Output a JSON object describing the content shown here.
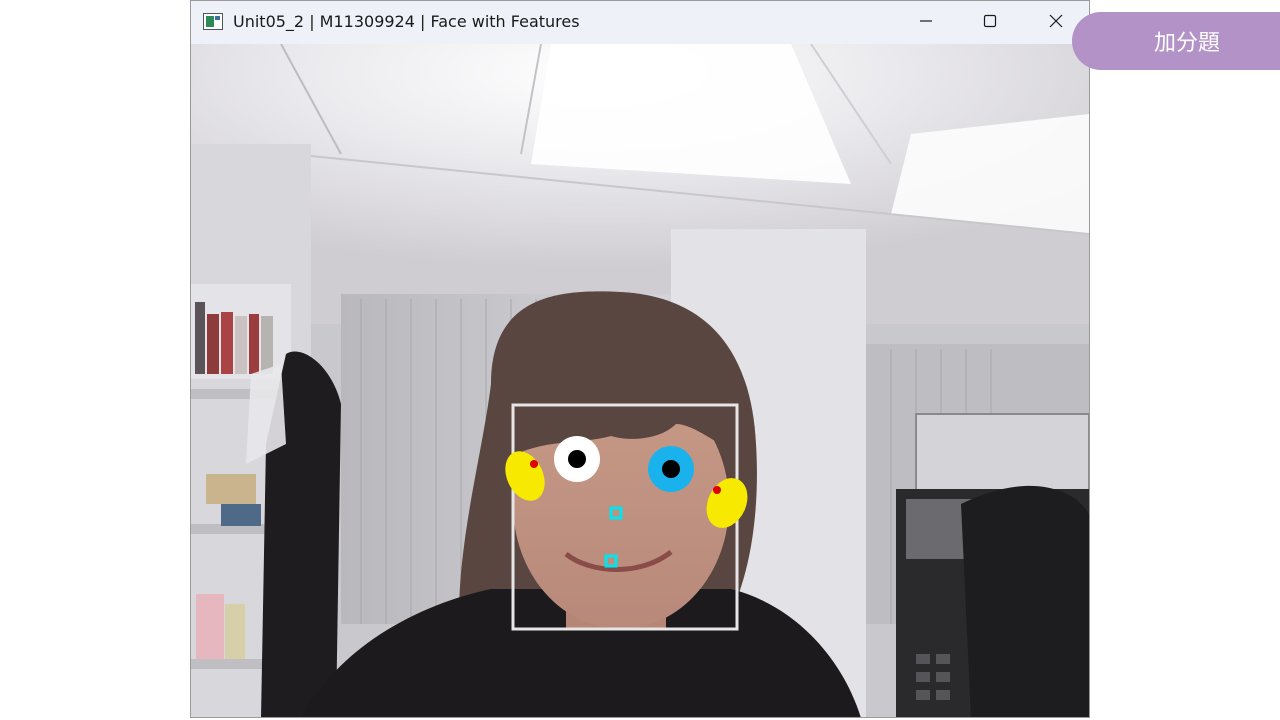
{
  "window": {
    "title": "Unit05_2 | M11309924 | Face with Features",
    "app_icon": "opencv-window-icon",
    "controls": {
      "minimize_icon": "minimize-icon",
      "maximize_icon": "maximize-icon",
      "close_icon": "close-icon"
    }
  },
  "video": {
    "scene": "webcam feed, office background",
    "face_box_color": "#e6e6e6",
    "features": {
      "left_eye": {
        "outer_color": "#ffffff",
        "pupil_color": "#000000"
      },
      "right_eye": {
        "outer_color": "#1ab2ec",
        "pupil_color": "#000000"
      },
      "cheeks_color": "#f7ea00",
      "cheek_marker_color": "#e00000",
      "nose_marker_color": "#00e5f0",
      "mouth_marker_color": "#00e5f0"
    }
  },
  "badge": {
    "label": "加分題",
    "color": "#b392c8"
  }
}
